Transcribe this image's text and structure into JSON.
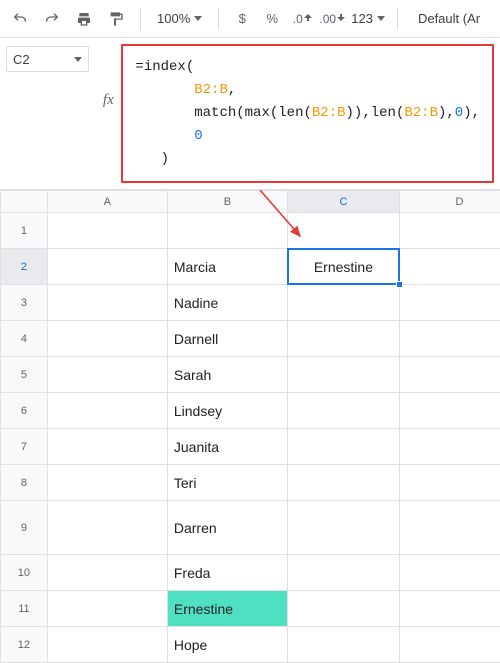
{
  "toolbar": {
    "zoom": "100%",
    "fmt_currency": "$",
    "fmt_percent": "%",
    "fmt_dec_dec": ".0",
    "fmt_dec_inc": ".00",
    "fmt_more": "123",
    "font_name": "Default (Ar"
  },
  "namebox": {
    "value": "C2"
  },
  "formula": {
    "raw": "=index(\n       B2:B,\n       match(max(len(B2:B)),len(B2:B),0),\n       0\n   )",
    "tokens": [
      [
        {
          "t": "=",
          "c": "punc"
        },
        {
          "t": "index",
          "c": "fn"
        },
        {
          "t": "(",
          "c": "punc"
        }
      ],
      [
        {
          "t": "       ",
          "c": "punc"
        },
        {
          "t": "B2:B",
          "c": "ref"
        },
        {
          "t": ",",
          "c": "punc"
        }
      ],
      [
        {
          "t": "       ",
          "c": "punc"
        },
        {
          "t": "match",
          "c": "fn"
        },
        {
          "t": "(",
          "c": "punc"
        },
        {
          "t": "max",
          "c": "fn"
        },
        {
          "t": "(",
          "c": "punc"
        },
        {
          "t": "len",
          "c": "fn"
        },
        {
          "t": "(",
          "c": "punc"
        },
        {
          "t": "B2:B",
          "c": "ref"
        },
        {
          "t": ")",
          "c": "punc"
        },
        {
          "t": ")",
          "c": "punc"
        },
        {
          "t": ",",
          "c": "punc"
        },
        {
          "t": "len",
          "c": "fn"
        },
        {
          "t": "(",
          "c": "punc"
        },
        {
          "t": "B2:B",
          "c": "ref"
        },
        {
          "t": ")",
          "c": "punc"
        },
        {
          "t": ",",
          "c": "punc"
        },
        {
          "t": "0",
          "c": "num"
        },
        {
          "t": ")",
          "c": "punc"
        },
        {
          "t": ",",
          "c": "punc"
        }
      ],
      [
        {
          "t": "       ",
          "c": "punc"
        },
        {
          "t": "0",
          "c": "num"
        }
      ],
      [
        {
          "t": "   ",
          "c": "punc"
        },
        {
          "t": ")",
          "c": "punc"
        }
      ]
    ]
  },
  "grid": {
    "columns": [
      "A",
      "B",
      "C",
      "D"
    ],
    "active_col": "C",
    "active_row": 2,
    "selected_cell": "C2",
    "rows": [
      {
        "n": 1,
        "B": "",
        "C": ""
      },
      {
        "n": 2,
        "B": "Marcia",
        "C": "Ernestine"
      },
      {
        "n": 3,
        "B": "Nadine",
        "C": ""
      },
      {
        "n": 4,
        "B": "Darnell",
        "C": ""
      },
      {
        "n": 5,
        "B": "Sarah",
        "C": ""
      },
      {
        "n": 6,
        "B": "Lindsey",
        "C": ""
      },
      {
        "n": 7,
        "B": "Juanita",
        "C": ""
      },
      {
        "n": 8,
        "B": "Teri",
        "C": ""
      },
      {
        "n": 9,
        "B": "Darren",
        "C": ""
      },
      {
        "n": 10,
        "B": "Freda",
        "C": ""
      },
      {
        "n": 11,
        "B": "Ernestine",
        "C": "",
        "highlight": "B"
      },
      {
        "n": 12,
        "B": "Hope",
        "C": ""
      }
    ]
  },
  "icons": {
    "undo": "undo-icon",
    "redo": "redo-icon",
    "print": "print-icon",
    "paint": "paint-format-icon",
    "dropdown": "chevron-down-icon"
  },
  "colors": {
    "annotation_red": "#e53935",
    "highlight": "#4fe0c2",
    "selection": "#1a73e8"
  }
}
